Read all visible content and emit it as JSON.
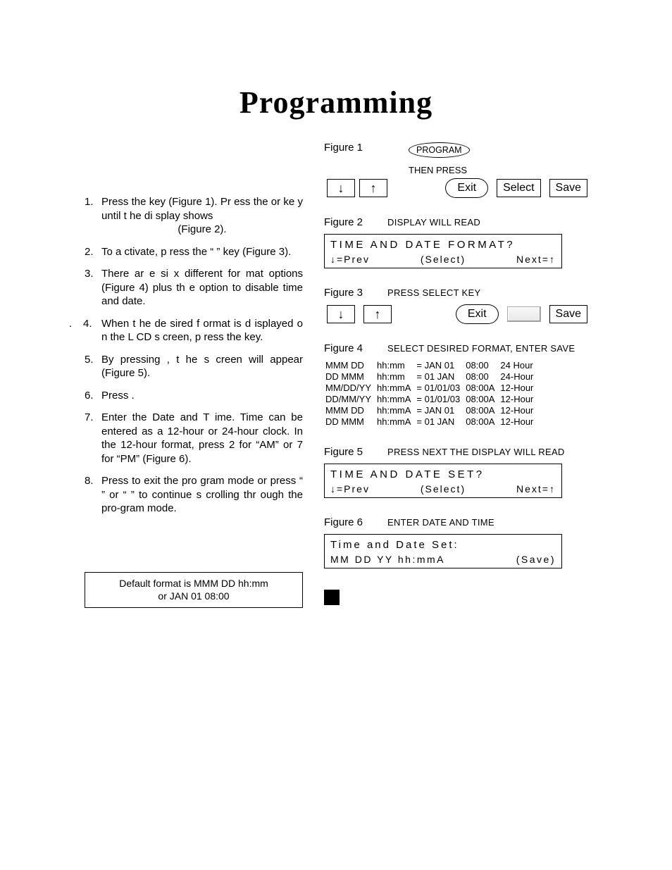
{
  "title": "Programming",
  "steps": {
    "s1": "Press the                         key (Figure 1).  Pr ess the           or               ke y until  t he di splay shows",
    "s1b": "(Figure 2).",
    "s2": "To a ctivate, p ress the “            ” key (Figure 3).",
    "s3": "There ar e si x different for mat options (Figure 4) plus th e option to disable time and date.",
    "s4pre": ".",
    "s4": "When t he de sired f ormat is d isplayed o n the L CD s creen, p ress the              key.",
    "s5": "By pressing         , t he s creen                                          will appear (Figure 5).",
    "s6": "Press              .",
    "s7": "Enter the Date and T ime. Time can be entered as a 12-hour or 24-hour clock. In the 12-hour format, press 2 for “AM” or 7 for “PM” (Figure 6).",
    "s8": "Press              to exit the pro gram mode or press “     ” or  “          ” to continue s crolling thr ough the pro-gram mode."
  },
  "note": {
    "l1": "Default format is MMM DD hh:mm",
    "l2": "or    JAN 01    08:00"
  },
  "fig1": {
    "label": "Figure 1",
    "program": "PROGRAM",
    "then": "THEN PRESS",
    "exit": "Exit",
    "select": "Select",
    "save": "Save"
  },
  "fig2": {
    "label": "Figure 2",
    "caption": "DISPLAY WILL READ",
    "line1": "TIME AND DATE FORMAT?",
    "prev": "↓=Prev",
    "sel": "(Select)",
    "next": "Next=↑"
  },
  "fig3": {
    "label": "Figure 3",
    "caption": "PRESS SELECT KEY",
    "exit": "Exit",
    "save": "Save"
  },
  "fig4": {
    "label": "Figure 4",
    "caption": "SELECT DESIRED FORMAT, ENTER SAVE",
    "rows": [
      {
        "c1": "MMM DD",
        "c2": "hh:mm",
        "c3": "= JAN 01",
        "c4": "08:00",
        "c5": "24 Hour"
      },
      {
        "c1": "DD MMM",
        "c2": "hh:mm",
        "c3": "= 01 JAN",
        "c4": "08:00",
        "c5": "24-Hour"
      },
      {
        "c1": "MM/DD/YY",
        "c2": "hh:mmA",
        "c3": "= 01/01/03",
        "c4": "08:00A",
        "c5": "12-Hour"
      },
      {
        "c1": "DD/MM/YY",
        "c2": "hh:mmA",
        "c3": "= 01/01/03",
        "c4": "08:00A",
        "c5": "12-Hour"
      },
      {
        "c1": "MMM DD",
        "c2": "hh:mmA",
        "c3": "= JAN 01",
        "c4": "08:00A",
        "c5": "12-Hour"
      },
      {
        "c1": "DD MMM",
        "c2": "hh:mmA",
        "c3": "= 01 JAN",
        "c4": "08:00A",
        "c5": "12-Hour"
      }
    ]
  },
  "fig5": {
    "label": "Figure 5",
    "caption": "PRESS NEXT THE DISPLAY WILL READ",
    "line1": "TIME AND DATE SET?",
    "prev": "↓=Prev",
    "sel": "(Select)",
    "next": "Next=↑"
  },
  "fig6": {
    "label": "Figure 6",
    "caption": "ENTER DATE AND TIME",
    "line1": "Time and Date Set:",
    "line2a": "MM DD YY  hh:mmA",
    "line2b": "(Save)"
  }
}
